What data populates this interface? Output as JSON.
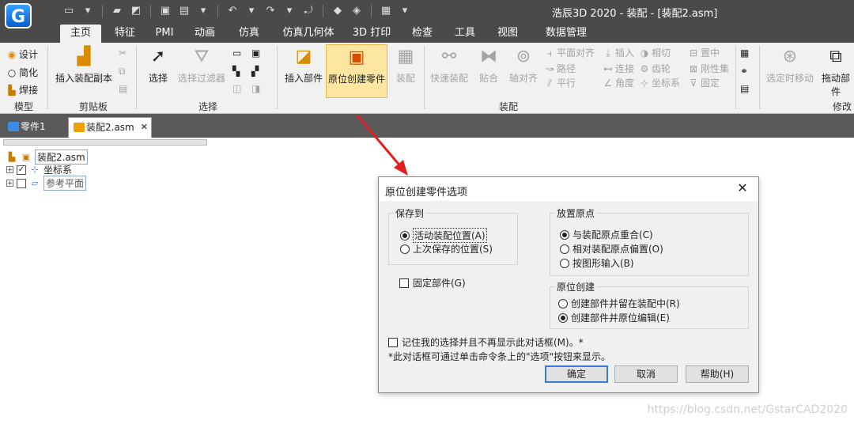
{
  "app": {
    "logo_glyph": "G",
    "window_title": "浩辰3D 2020 - 装配 - [装配2.asm]"
  },
  "ribbon_tabs": [
    "主页",
    "特征",
    "PMI",
    "动画",
    "仿真",
    "仿真几何体",
    "3D 打印",
    "检查",
    "工具",
    "视图",
    "数据管理"
  ],
  "ribbon": {
    "model": {
      "items": [
        "设计",
        "简化",
        "焊接"
      ],
      "label": "模型"
    },
    "clipboard": {
      "paste_label": "插入装配副本",
      "label": "剪贴板"
    },
    "select": {
      "select_label": "选择",
      "filter_label": "选择过滤器",
      "label": "选择"
    },
    "assembly": {
      "insert_part": "插入部件",
      "inplace_create": "原位创建零件",
      "assemble": "装配",
      "quick_assemble": "快速装配",
      "fit": "贴合",
      "axial_align": "轴对齐",
      "col1": [
        "平面对齐",
        "路径",
        "平行"
      ],
      "col2": [
        "插入",
        "连接",
        "角度"
      ],
      "col3": [
        "相切",
        "齿轮",
        "坐标系"
      ],
      "col4": [
        "置中",
        "刚性集",
        "固定"
      ],
      "label": "装配"
    },
    "modify": {
      "move_label": "选定时移动",
      "drag_label": "拖动部件",
      "label": "修改"
    }
  },
  "doc_tabs": [
    {
      "label": "零件1",
      "active": false
    },
    {
      "label": "装配2.asm",
      "active": true
    }
  ],
  "tree": {
    "root": "装配2.asm",
    "children": [
      "坐标系",
      "参考平面"
    ]
  },
  "dialog": {
    "title": "原位创建零件选项",
    "save_to": {
      "legend": "保存到",
      "options": [
        "活动装配位置(A)",
        "上次保存的位置(S)"
      ],
      "selected": 0
    },
    "fix_part": "固定部件(G)",
    "placement": {
      "legend": "放置原点",
      "options": [
        "与装配原点重合(C)",
        "相对装配原点偏置(O)",
        "按图形输入(B)"
      ],
      "selected": 0
    },
    "inplace": {
      "legend": "原位创建",
      "options": [
        "创建部件并留在装配中(R)",
        "创建部件并原位编辑(E)"
      ],
      "selected": 1
    },
    "remember": "记住我的选择并且不再显示此对话框(M)。*",
    "footnote": "*此对话框可通过单击命令条上的\"选项\"按钮来显示。",
    "buttons": {
      "ok": "确定",
      "cancel": "取消",
      "help": "帮助(H)"
    }
  },
  "watermark": "https://blog.csdn.net/GstarCAD2020"
}
